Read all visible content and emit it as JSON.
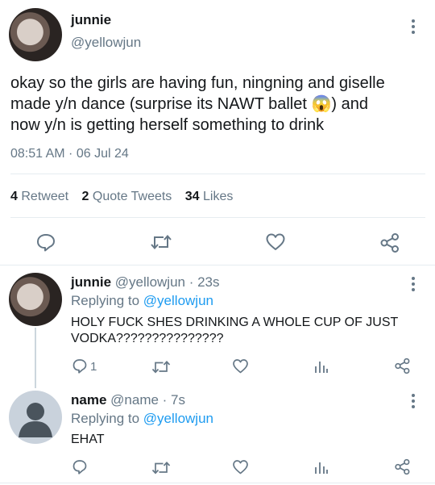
{
  "main_tweet": {
    "display_name": "junnie",
    "handle": "@yellowjun",
    "text_line1": "okay so the girls are having fun, ningning and giselle",
    "text_line2_a": "made y/n dance (surprise its NAWT ballet",
    "text_line2_emoji": "😱",
    "text_line2_b": ") and",
    "text_line3": "now y/n is getting herself something to drink",
    "timestamp": "08:51 AM · 06 Jul 24",
    "retweets_count": "4",
    "retweets_label": "Retweet",
    "quotes_count": "2",
    "quotes_label": "Quote Tweets",
    "likes_count": "34",
    "likes_label": "Likes",
    "actions": [
      "reply-icon",
      "retweet-icon",
      "like-icon",
      "share-icon"
    ]
  },
  "replies": [
    {
      "display_name": "junnie",
      "meta": "@yellowjun · 23s",
      "replying_label": "Replying to",
      "replying_to": "@yellowjun",
      "text_line1": "HOLY FUCK SHES DRINKING A WHOLE CUP OF JUST",
      "text_line2": "VODKA???????????????",
      "reply_count": "1"
    },
    {
      "display_name": "name",
      "meta": "@name · 7s",
      "replying_label": "Replying to",
      "replying_to": "@yellowjun",
      "text_line1": "EHAT"
    }
  ],
  "colors": {
    "accent": "#1d9bf0",
    "muted": "#657786",
    "divider": "#e6ecf0"
  }
}
